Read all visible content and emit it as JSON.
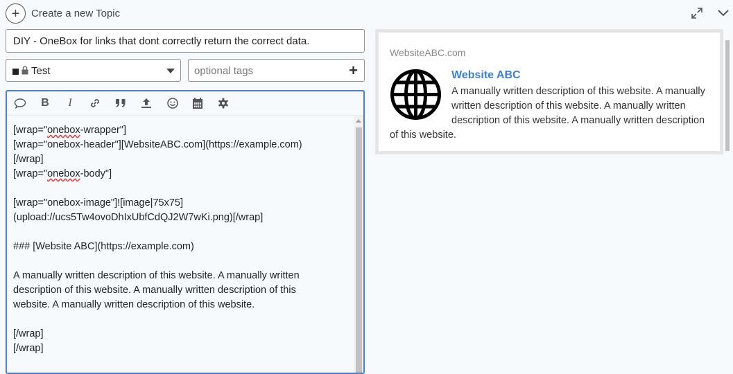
{
  "header": {
    "new_topic_label": "Create a new Topic",
    "plus_icon": "+"
  },
  "composer": {
    "title_value": "DIY - OneBox for links that dont correctly return the correct data.",
    "category": {
      "name": "Test",
      "color": "#222222",
      "locked": true
    },
    "tags_placeholder": "optional tags",
    "tags_plus": "+"
  },
  "editor": {
    "lines": [
      [
        "[wrap=\"",
        {
          "spell": "onebox"
        },
        "-wrapper\"]"
      ],
      [
        "[wrap=\"onebox-header\"][WebsiteABC.com](https://example.com)"
      ],
      [
        "[/wrap]"
      ],
      [
        "[wrap=\"",
        {
          "spell": "onebox"
        },
        "-body\"]"
      ],
      [
        ""
      ],
      [
        "[wrap=\"onebox-image\"]![image|75x75]"
      ],
      [
        "(upload://ucs5Tw4ovoDhIxUbfCdQJ2W7wKi.png)[/wrap]"
      ],
      [
        ""
      ],
      [
        "### [Website ABC](https://example.com)"
      ],
      [
        ""
      ],
      [
        "A manually written description of this website. A manually written"
      ],
      [
        "description of this website. A manually written description of this"
      ],
      [
        "website. A manually written description of this website."
      ],
      [
        ""
      ],
      [
        "[/wrap]"
      ],
      [
        "[/wrap]"
      ]
    ]
  },
  "preview": {
    "header": "WebsiteABC.com",
    "title": "Website ABC",
    "description": "A manually written description of this website. A manually written description of this website. A manually written description of this website. A manually written description of this website.",
    "link_color": "#3b7fd8"
  },
  "colors": {
    "editor_border": "#4a7ec9",
    "background": "#f6fafd"
  }
}
